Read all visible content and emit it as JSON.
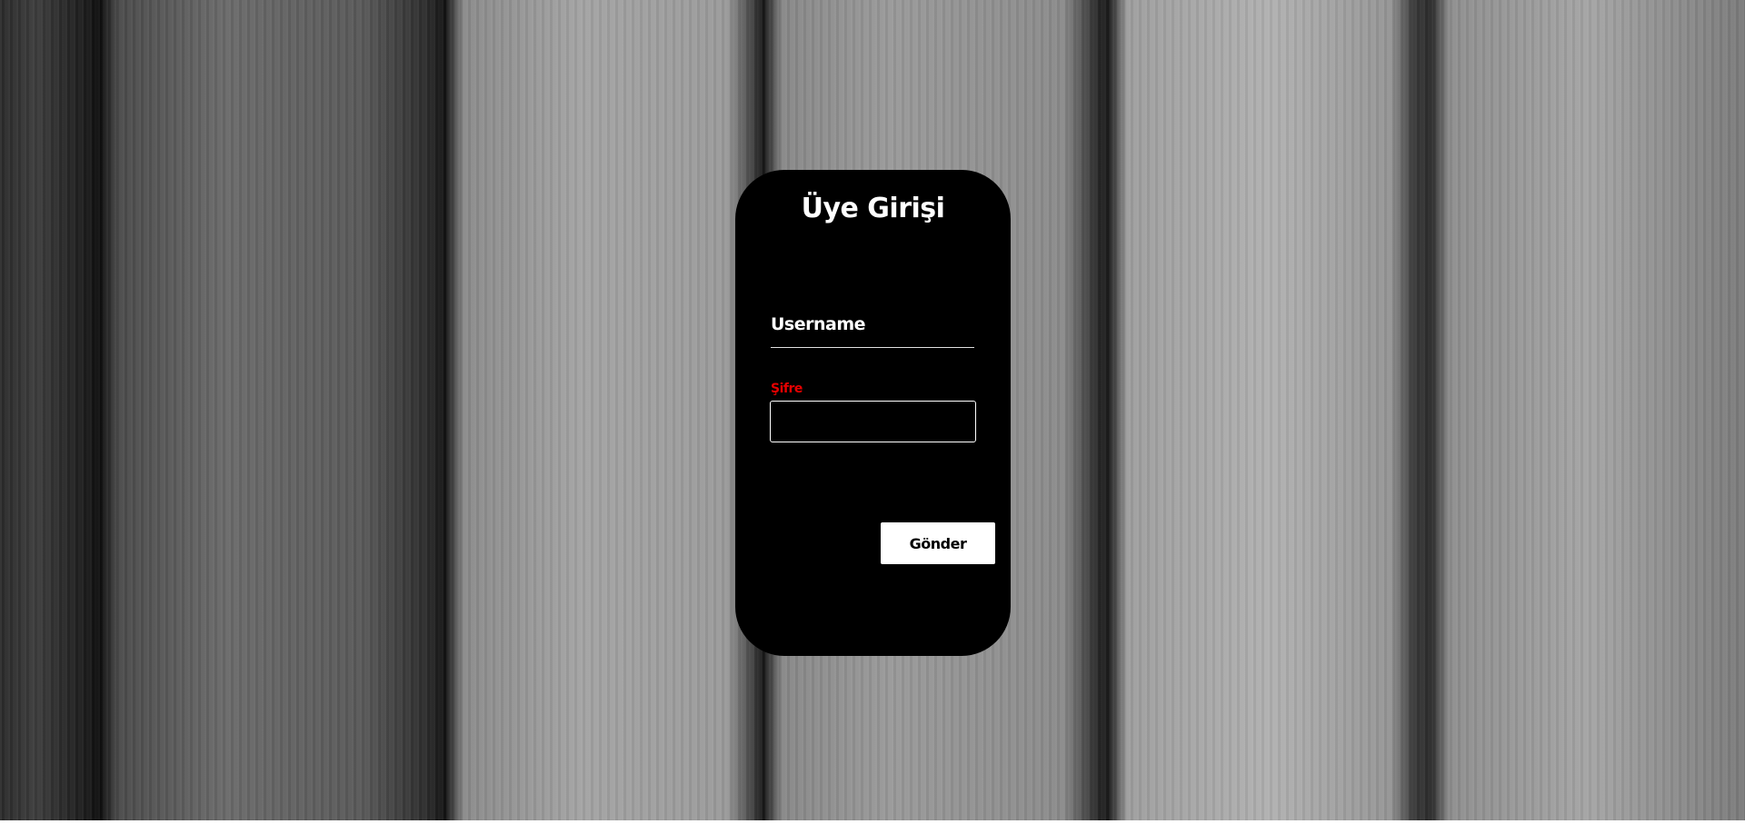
{
  "login": {
    "title": "Üye Girişi",
    "username_label": "Username",
    "username_value": "",
    "password_label": "Şifre",
    "password_value": "",
    "submit_label": "Gönder"
  },
  "colors": {
    "card_background": "#000000",
    "title_text": "#ffffff",
    "password_label_text": "#e60000",
    "button_background": "#ffffff",
    "button_text": "#000000"
  },
  "background": {
    "description_icon": "wood-plank-texture"
  }
}
